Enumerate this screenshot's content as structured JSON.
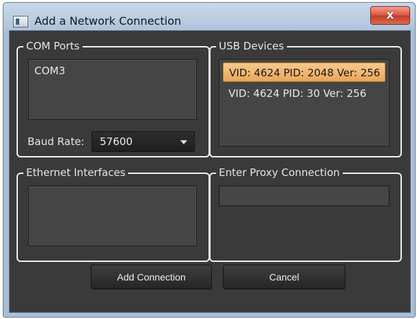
{
  "window": {
    "title": "Add a Network Connection",
    "close_label": "x"
  },
  "com_ports": {
    "legend": "COM Ports",
    "items": [
      "COM3"
    ],
    "baud_label": "Baud Rate:",
    "baud_value": "57600"
  },
  "usb_devices": {
    "legend": "USB Devices",
    "items": [
      {
        "label": "VID: 4624 PID: 2048 Ver: 256",
        "selected": true
      },
      {
        "label": "VID: 4624 PID: 30 Ver: 256",
        "selected": false
      }
    ]
  },
  "ethernet": {
    "legend": "Ethernet Interfaces",
    "items": []
  },
  "proxy": {
    "legend": "Enter Proxy Connection",
    "value": ""
  },
  "buttons": {
    "add": "Add Connection",
    "cancel": "Cancel"
  },
  "colors": {
    "client_bg": "#3a3a3a",
    "selection": "#eaa65a",
    "close_button": "#c13c25"
  }
}
